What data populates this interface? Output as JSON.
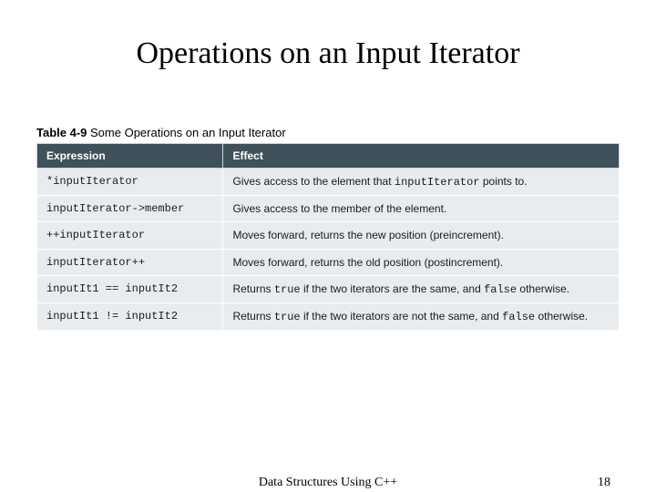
{
  "title": "Operations on an Input Iterator",
  "table": {
    "caption_label": "Table 4-9",
    "caption_text": "Some Operations on an Input Iterator",
    "headers": {
      "expression": "Expression",
      "effect": "Effect"
    },
    "rows": [
      {
        "expr": "*inputIterator",
        "effect_pre": "Gives access to the element that ",
        "effect_code": "inputIterator",
        "effect_post": " points to."
      },
      {
        "expr": "inputIterator->member",
        "effect_pre": "Gives access to the member of the element.",
        "effect_code": "",
        "effect_post": ""
      },
      {
        "expr": "++inputIterator",
        "effect_pre": "Moves forward, returns the new position (preincrement).",
        "effect_code": "",
        "effect_post": ""
      },
      {
        "expr": "inputIterator++",
        "effect_pre": "Moves forward, returns the old position (postincrement).",
        "effect_code": "",
        "effect_post": ""
      },
      {
        "expr": "inputIt1 == inputIt2",
        "effect_pre": "Returns ",
        "effect_code": "true",
        "effect_post": " if the two iterators are the same, and ",
        "effect_code2": "false",
        "effect_post2": " otherwise."
      },
      {
        "expr": "inputIt1 != inputIt2",
        "effect_pre": "Returns ",
        "effect_code": "true",
        "effect_post": " if the two iterators are not the same, and ",
        "effect_code2": "false",
        "effect_post2": " otherwise."
      }
    ]
  },
  "footer": {
    "source": "Data Structures Using C++",
    "page": "18"
  }
}
